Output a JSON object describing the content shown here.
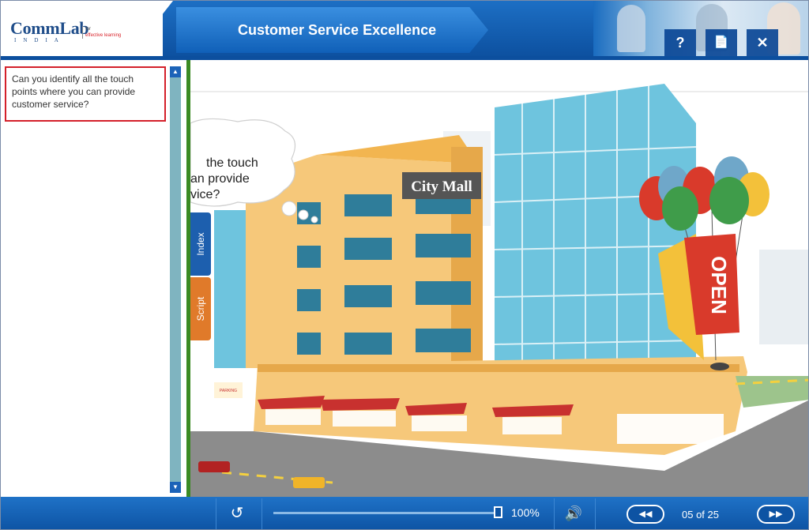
{
  "header": {
    "logo_text": "CommLab",
    "logo_sub": "INDIA",
    "logo_for": "for",
    "logo_tagline": "effective learning",
    "title": "Customer Service Excellence",
    "help_label": "?",
    "notes_label": "📄",
    "close_label": "✕"
  },
  "left_panel": {
    "question": "Can you identify all the touch points where you can provide customer service?",
    "scroll_up": "▲",
    "scroll_down": "▼"
  },
  "scene": {
    "bubble_lines": [
      "the touch",
      "an provide",
      "vice?"
    ],
    "mall_sign": "City Mall",
    "open_sign": "OPEN",
    "parking_sign": "PARKING"
  },
  "side_tabs": {
    "index": "Index",
    "script": "Script"
  },
  "footer": {
    "replay_icon": "↺",
    "zoom": "100%",
    "volume_icon": "🔊",
    "prev_icon": "◀◀",
    "next_icon": "▶▶",
    "page_indicator": "05 of 25"
  },
  "colors": {
    "header_blue": "#1d6fc4",
    "accent_red": "#d4202a",
    "divider_green": "#3a8a23",
    "index_tab": "#1d5fae",
    "script_tab": "#e07a2a"
  }
}
